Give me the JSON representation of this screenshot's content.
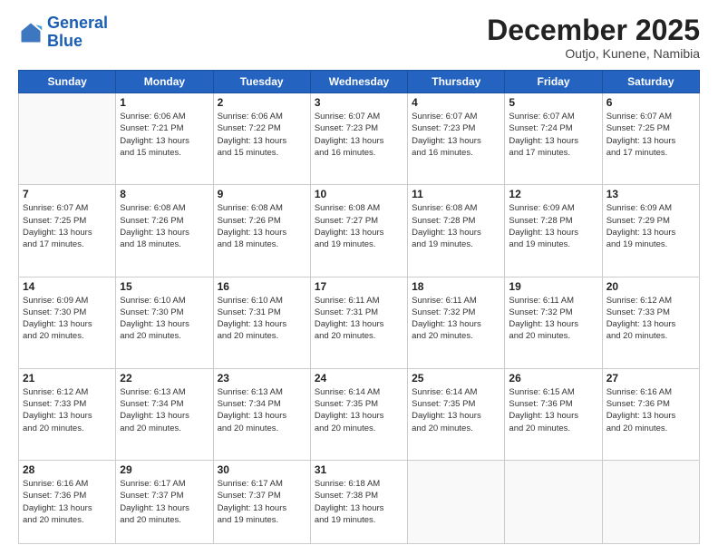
{
  "logo": {
    "line1": "General",
    "line2": "Blue"
  },
  "title": "December 2025",
  "subtitle": "Outjo, Kunene, Namibia",
  "weekdays": [
    "Sunday",
    "Monday",
    "Tuesday",
    "Wednesday",
    "Thursday",
    "Friday",
    "Saturday"
  ],
  "weeks": [
    [
      {
        "day": "",
        "info": ""
      },
      {
        "day": "1",
        "info": "Sunrise: 6:06 AM\nSunset: 7:21 PM\nDaylight: 13 hours\nand 15 minutes."
      },
      {
        "day": "2",
        "info": "Sunrise: 6:06 AM\nSunset: 7:22 PM\nDaylight: 13 hours\nand 15 minutes."
      },
      {
        "day": "3",
        "info": "Sunrise: 6:07 AM\nSunset: 7:23 PM\nDaylight: 13 hours\nand 16 minutes."
      },
      {
        "day": "4",
        "info": "Sunrise: 6:07 AM\nSunset: 7:23 PM\nDaylight: 13 hours\nand 16 minutes."
      },
      {
        "day": "5",
        "info": "Sunrise: 6:07 AM\nSunset: 7:24 PM\nDaylight: 13 hours\nand 17 minutes."
      },
      {
        "day": "6",
        "info": "Sunrise: 6:07 AM\nSunset: 7:25 PM\nDaylight: 13 hours\nand 17 minutes."
      }
    ],
    [
      {
        "day": "7",
        "info": "Sunrise: 6:07 AM\nSunset: 7:25 PM\nDaylight: 13 hours\nand 17 minutes."
      },
      {
        "day": "8",
        "info": "Sunrise: 6:08 AM\nSunset: 7:26 PM\nDaylight: 13 hours\nand 18 minutes."
      },
      {
        "day": "9",
        "info": "Sunrise: 6:08 AM\nSunset: 7:26 PM\nDaylight: 13 hours\nand 18 minutes."
      },
      {
        "day": "10",
        "info": "Sunrise: 6:08 AM\nSunset: 7:27 PM\nDaylight: 13 hours\nand 19 minutes."
      },
      {
        "day": "11",
        "info": "Sunrise: 6:08 AM\nSunset: 7:28 PM\nDaylight: 13 hours\nand 19 minutes."
      },
      {
        "day": "12",
        "info": "Sunrise: 6:09 AM\nSunset: 7:28 PM\nDaylight: 13 hours\nand 19 minutes."
      },
      {
        "day": "13",
        "info": "Sunrise: 6:09 AM\nSunset: 7:29 PM\nDaylight: 13 hours\nand 19 minutes."
      }
    ],
    [
      {
        "day": "14",
        "info": "Sunrise: 6:09 AM\nSunset: 7:30 PM\nDaylight: 13 hours\nand 20 minutes."
      },
      {
        "day": "15",
        "info": "Sunrise: 6:10 AM\nSunset: 7:30 PM\nDaylight: 13 hours\nand 20 minutes."
      },
      {
        "day": "16",
        "info": "Sunrise: 6:10 AM\nSunset: 7:31 PM\nDaylight: 13 hours\nand 20 minutes."
      },
      {
        "day": "17",
        "info": "Sunrise: 6:11 AM\nSunset: 7:31 PM\nDaylight: 13 hours\nand 20 minutes."
      },
      {
        "day": "18",
        "info": "Sunrise: 6:11 AM\nSunset: 7:32 PM\nDaylight: 13 hours\nand 20 minutes."
      },
      {
        "day": "19",
        "info": "Sunrise: 6:11 AM\nSunset: 7:32 PM\nDaylight: 13 hours\nand 20 minutes."
      },
      {
        "day": "20",
        "info": "Sunrise: 6:12 AM\nSunset: 7:33 PM\nDaylight: 13 hours\nand 20 minutes."
      }
    ],
    [
      {
        "day": "21",
        "info": "Sunrise: 6:12 AM\nSunset: 7:33 PM\nDaylight: 13 hours\nand 20 minutes."
      },
      {
        "day": "22",
        "info": "Sunrise: 6:13 AM\nSunset: 7:34 PM\nDaylight: 13 hours\nand 20 minutes."
      },
      {
        "day": "23",
        "info": "Sunrise: 6:13 AM\nSunset: 7:34 PM\nDaylight: 13 hours\nand 20 minutes."
      },
      {
        "day": "24",
        "info": "Sunrise: 6:14 AM\nSunset: 7:35 PM\nDaylight: 13 hours\nand 20 minutes."
      },
      {
        "day": "25",
        "info": "Sunrise: 6:14 AM\nSunset: 7:35 PM\nDaylight: 13 hours\nand 20 minutes."
      },
      {
        "day": "26",
        "info": "Sunrise: 6:15 AM\nSunset: 7:36 PM\nDaylight: 13 hours\nand 20 minutes."
      },
      {
        "day": "27",
        "info": "Sunrise: 6:16 AM\nSunset: 7:36 PM\nDaylight: 13 hours\nand 20 minutes."
      }
    ],
    [
      {
        "day": "28",
        "info": "Sunrise: 6:16 AM\nSunset: 7:36 PM\nDaylight: 13 hours\nand 20 minutes."
      },
      {
        "day": "29",
        "info": "Sunrise: 6:17 AM\nSunset: 7:37 PM\nDaylight: 13 hours\nand 20 minutes."
      },
      {
        "day": "30",
        "info": "Sunrise: 6:17 AM\nSunset: 7:37 PM\nDaylight: 13 hours\nand 19 minutes."
      },
      {
        "day": "31",
        "info": "Sunrise: 6:18 AM\nSunset: 7:38 PM\nDaylight: 13 hours\nand 19 minutes."
      },
      {
        "day": "",
        "info": ""
      },
      {
        "day": "",
        "info": ""
      },
      {
        "day": "",
        "info": ""
      }
    ]
  ]
}
